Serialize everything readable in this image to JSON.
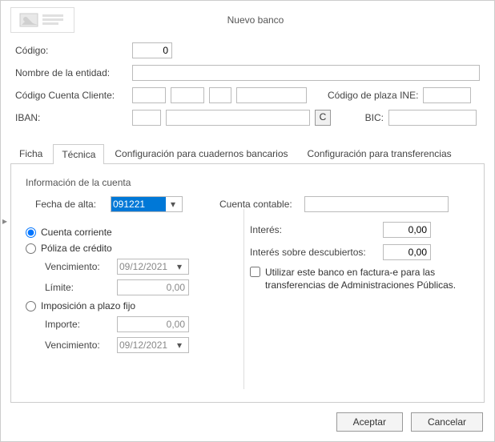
{
  "title": "Nuevo banco",
  "top": {
    "codigo_label": "Código:",
    "codigo_value": "0",
    "nombre_label": "Nombre de la entidad:",
    "nombre_value": "",
    "ccc_label": "Código Cuenta Cliente:",
    "ccc1": "",
    "ccc2": "",
    "ccc3": "",
    "ccc4": "",
    "plaza_label": "Código de plaza INE:",
    "plaza_value": "",
    "iban_label": "IBAN:",
    "iban1": "",
    "iban2": "",
    "calc_button": "C",
    "bic_label": "BIC:",
    "bic_value": ""
  },
  "tabs": {
    "t1": "Ficha",
    "t2": "Técnica",
    "t3": "Configuración para cuadernos bancarios",
    "t4": "Configuración para transferencias"
  },
  "tecnica": {
    "section": "Información de la cuenta",
    "fecha_alta_label": "Fecha de alta:",
    "fecha_alta_value": "091221",
    "cuenta_contable_label": "Cuenta contable:",
    "cuenta_contable_value": "",
    "opt_cc": "Cuenta corriente",
    "opt_poliza": "Póliza de crédito",
    "poliza_venc_label": "Vencimiento:",
    "poliza_venc_value": "09/12/2021",
    "poliza_limite_label": "Límite:",
    "poliza_limite_value": "0,00",
    "opt_impos": "Imposición a plazo fijo",
    "impos_importe_label": "Importe:",
    "impos_importe_value": "0,00",
    "impos_venc_label": "Vencimiento:",
    "impos_venc_value": "09/12/2021",
    "interes_label": "Interés:",
    "interes_value": "0,00",
    "interes_desc_label": "Interés sobre descubiertos:",
    "interes_desc_value": "0,00",
    "check_facturae": "Utilizar este banco en factura-e para las transferencias de Administraciones Públicas."
  },
  "buttons": {
    "ok": "Aceptar",
    "cancel": "Cancelar"
  }
}
